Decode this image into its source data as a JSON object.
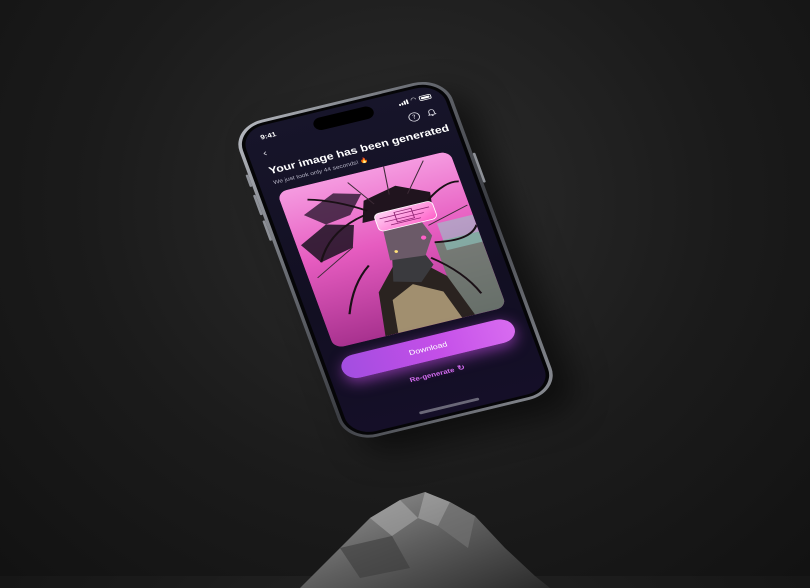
{
  "status_bar": {
    "time": "9:41"
  },
  "header": {
    "back_icon": "chevron-left-icon",
    "help_icon": "question-circle-icon",
    "notification_icon": "bell-icon"
  },
  "result": {
    "title": "Your image has been generated",
    "subtitle": "We just took only 44 seconds! 🔥",
    "image": "generated-cyberpunk-portrait"
  },
  "actions": {
    "download_label": "Download",
    "regenerate_label": "Re-generate",
    "regenerate_icon": "refresh-icon"
  },
  "colors": {
    "accent": "#c44fe8",
    "screen_background": "#15122a",
    "page_background": "#1b1b1b"
  }
}
